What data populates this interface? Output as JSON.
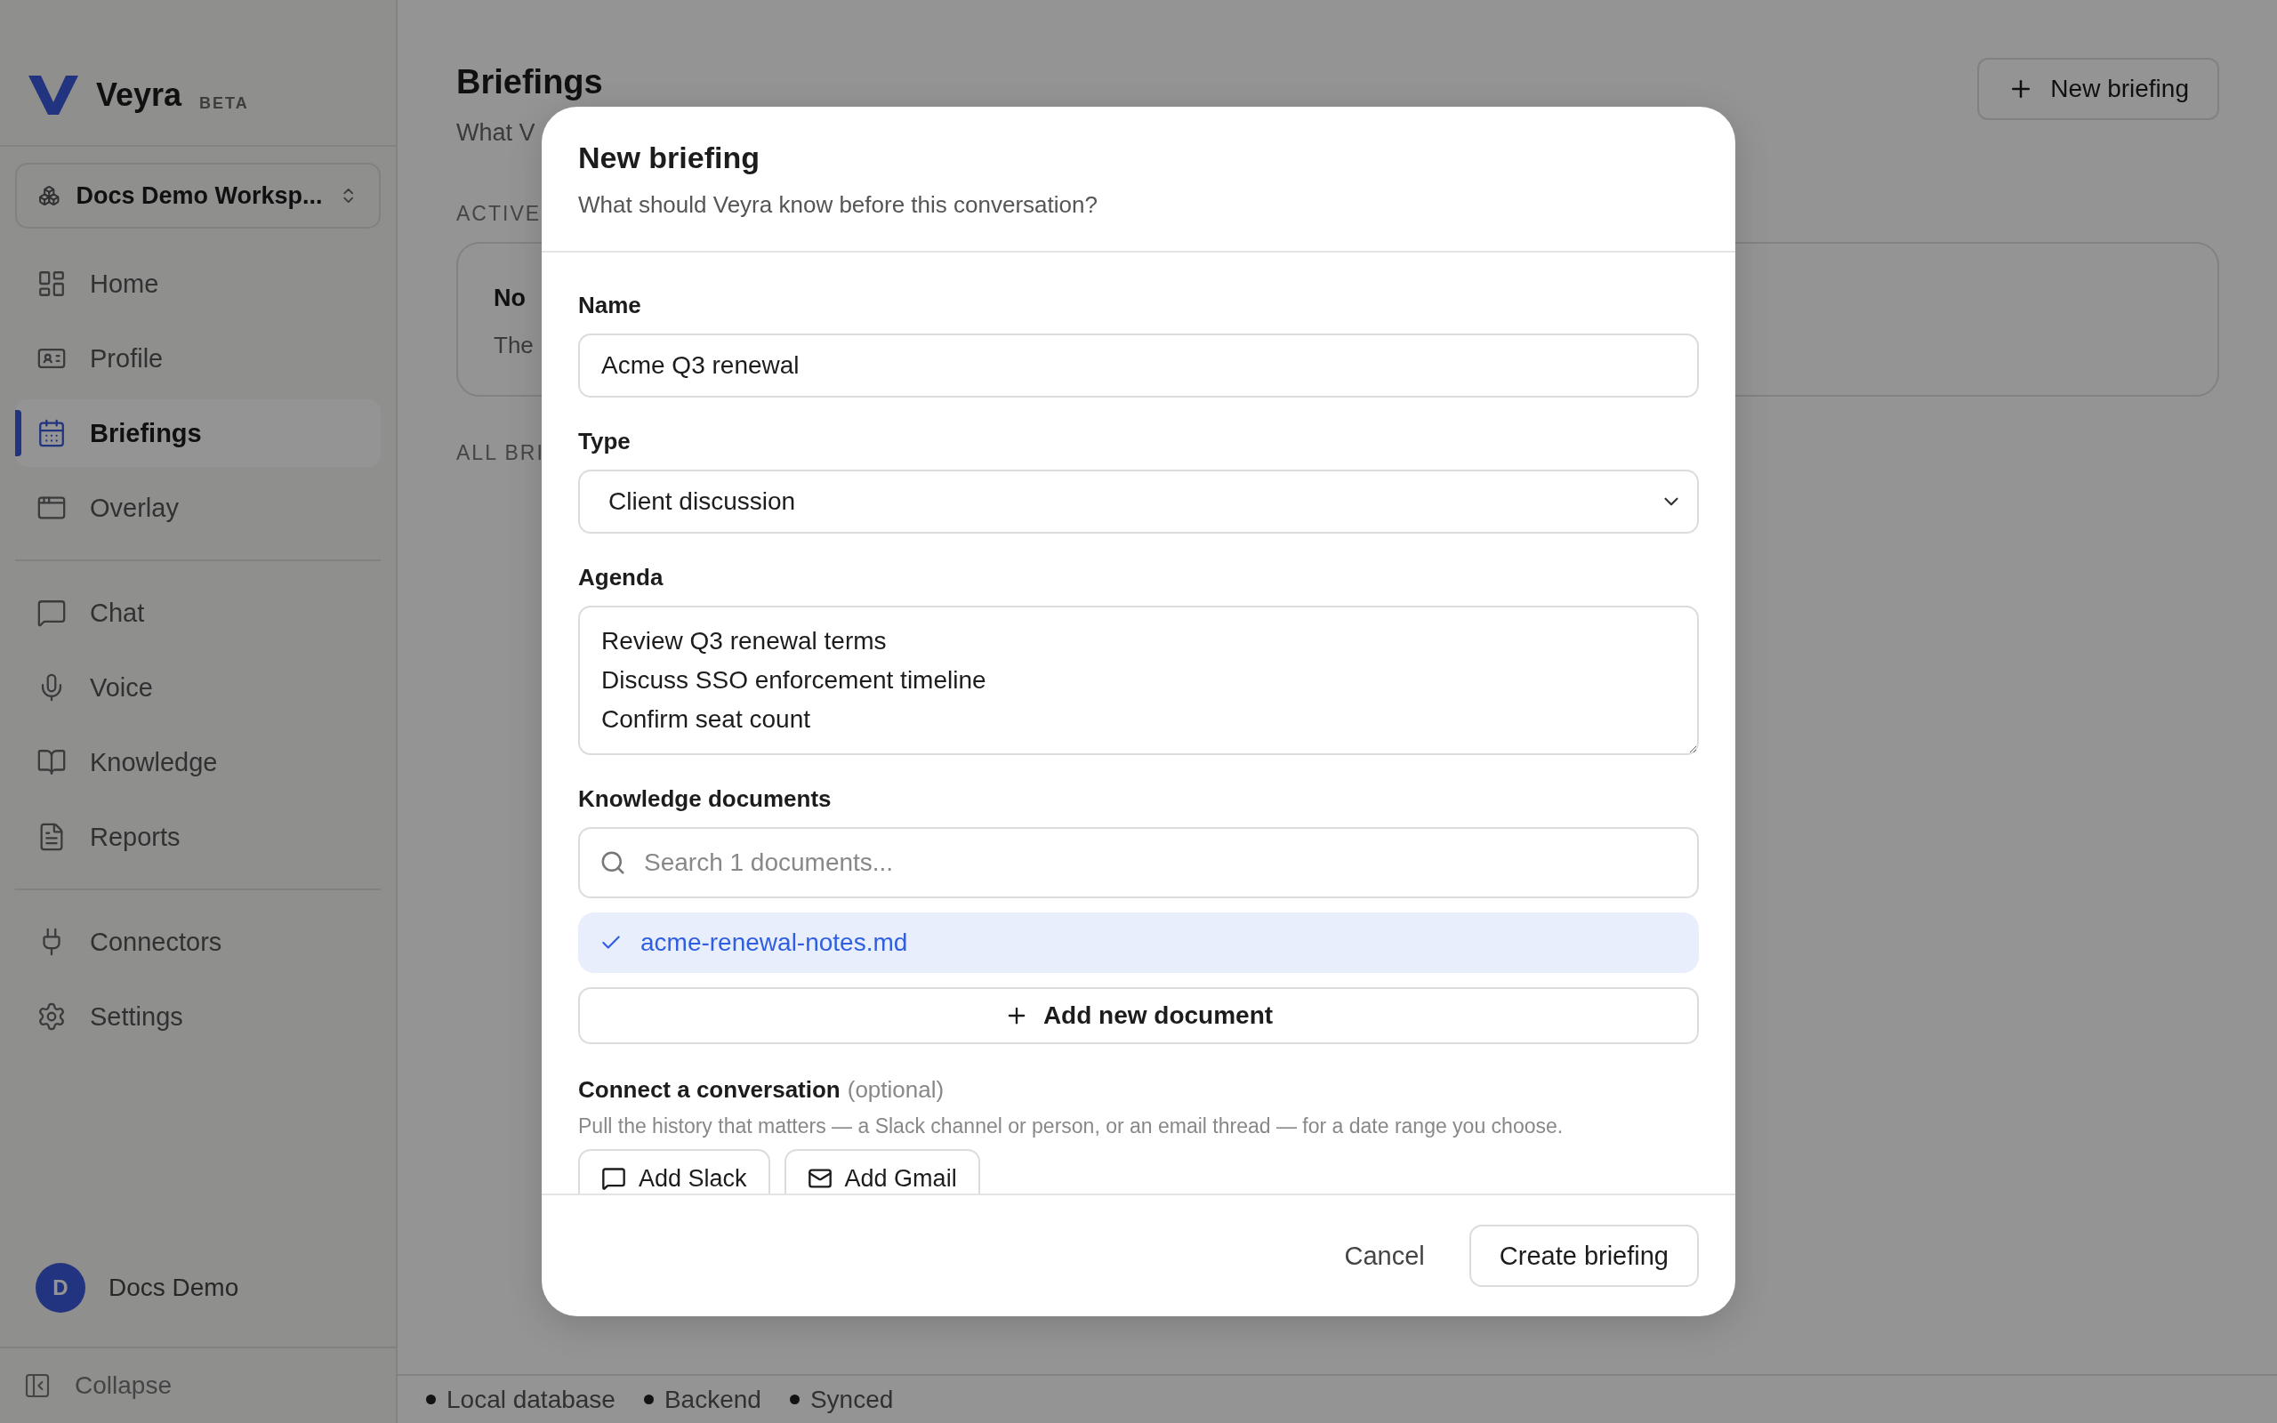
{
  "sidebar": {
    "logo": {
      "name": "Veyra",
      "badge": "BETA"
    },
    "workspace": "Docs Demo Worksp...",
    "nav_groups": [
      [
        {
          "label": "Home",
          "selected": false
        },
        {
          "label": "Profile",
          "selected": false
        },
        {
          "label": "Briefings",
          "selected": true
        },
        {
          "label": "Overlay",
          "selected": false
        }
      ],
      [
        {
          "label": "Chat",
          "selected": false
        },
        {
          "label": "Voice",
          "selected": false
        },
        {
          "label": "Knowledge",
          "selected": false
        },
        {
          "label": "Reports",
          "selected": false
        }
      ],
      [
        {
          "label": "Connectors",
          "selected": false
        },
        {
          "label": "Settings",
          "selected": false
        }
      ]
    ],
    "user": {
      "initial": "D",
      "name": "Docs Demo"
    },
    "collapse": "Collapse"
  },
  "page": {
    "title": "Briefings",
    "subtitle": "What V",
    "new_button": "New briefing",
    "active_heading": "ACTIVE",
    "empty_card": {
      "title": "No",
      "text": "The"
    },
    "all_heading": "ALL BRI"
  },
  "dialog": {
    "title": "New briefing",
    "subtitle": "What should Veyra know before this conversation?",
    "name": {
      "label": "Name",
      "value": "Acme Q3 renewal"
    },
    "type": {
      "label": "Type",
      "value": "Client discussion"
    },
    "agenda": {
      "label": "Agenda",
      "value": "Review Q3 renewal terms\nDiscuss SSO enforcement timeline\nConfirm seat count"
    },
    "knowledge": {
      "label": "Knowledge documents",
      "placeholder": "Search 1 documents...",
      "documents": [
        {
          "name": "acme-renewal-notes.md",
          "selected": true
        }
      ],
      "add_button": "Add new document"
    },
    "connect": {
      "label": "Connect a conversation",
      "hint": "(optional)",
      "description": "Pull the history that matters — a Slack channel or person, or an email thread — for a date range you choose.",
      "buttons": [
        {
          "label": "Add Slack"
        },
        {
          "label": "Add Gmail"
        }
      ]
    },
    "cancel": "Cancel",
    "create": "Create briefing"
  },
  "status_bar": [
    {
      "label": "Local database"
    },
    {
      "label": "Backend"
    },
    {
      "label": "Synced"
    }
  ]
}
